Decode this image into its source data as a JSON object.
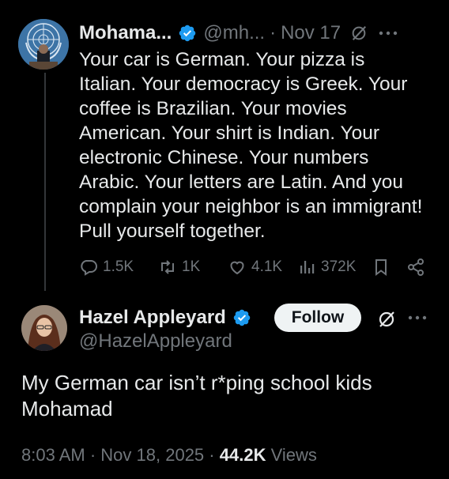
{
  "parent": {
    "name": "Mohama...",
    "handle": "@mh...",
    "separator": "·",
    "date": "Nov 17",
    "text": "Your car is German. Your pizza is Italian. Your democracy is Greek. Your coffee is Brazilian. Your movies American. Your shirt is Indian. Your electronic Chinese. Your numbers Arabic. Your letters are Latin. And you complain your neighbor is an immigrant! Pull yourself together.",
    "stats": {
      "replies": "1.5K",
      "reposts": "1K",
      "likes": "4.1K",
      "views": "372K"
    },
    "avatar_icon": "un-emblem-avatar",
    "verified_icon": "verified-badge-icon"
  },
  "reply": {
    "name": "Hazel Appleyard",
    "handle": "@HazelAppleyard",
    "follow_label": "Follow",
    "text": "My German car isn’t r*ping school kids Mohamad",
    "time": "8:03 AM",
    "separator": "·",
    "date": "Nov 18, 2025",
    "views_count": "44.2K",
    "views_label": "Views",
    "verified_icon": "verified-badge-icon"
  },
  "colors": {
    "background": "#000000",
    "text": "#e7e9ea",
    "muted": "#71767b",
    "verified": "#1d9bf0",
    "follow_bg": "#eff3f4"
  }
}
